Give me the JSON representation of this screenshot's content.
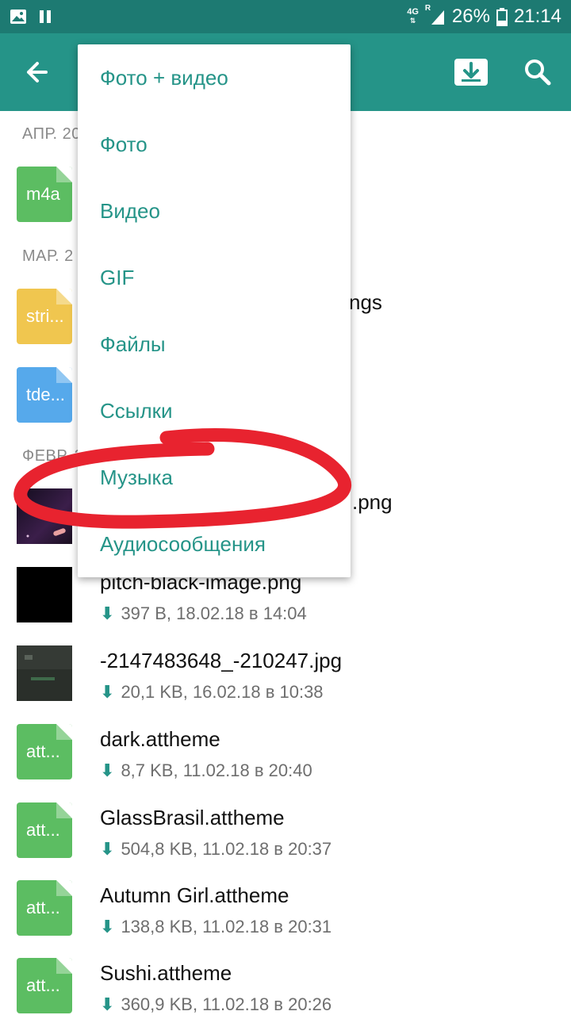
{
  "status_bar": {
    "network": "4G",
    "roaming": "R",
    "battery": "26%",
    "time": "21:14"
  },
  "colors": {
    "appbar": "#259488",
    "statusbar": "#1d7a72",
    "accent": "#259488",
    "annotation": "#e8232f"
  },
  "sections": [
    {
      "label": "АПР. 20"
    },
    {
      "label": "МАР. 2"
    },
    {
      "label": "ФЕВР. 2"
    }
  ],
  "visible_tail_texts": {
    "strings_tail": "ngs",
    "png_tail": ".png"
  },
  "files": [
    {
      "icon_label": "m4a",
      "icon_color": "#5cbd62"
    },
    {
      "icon_label": "stri...",
      "icon_color": "#f0c64f"
    },
    {
      "icon_label": "tde...",
      "icon_color": "#56a9eb"
    },
    {
      "icon": "dark-image-thumbnail"
    },
    {
      "name": "pitch-black-image.png",
      "meta": "397 B, 18.02.18 в 14:04"
    },
    {
      "name": "-2147483648_-210247.jpg",
      "meta": "20,1 KB, 16.02.18 в 10:38"
    },
    {
      "icon_label": "att...",
      "name": "dark.attheme",
      "meta": "8,7 KB, 11.02.18 в 20:40"
    },
    {
      "icon_label": "att...",
      "name": "GlassBrasil.attheme",
      "meta": "504,8 KB, 11.02.18 в 20:37"
    },
    {
      "icon_label": "att...",
      "name": "Autumn Girl.attheme",
      "meta": "138,8 KB, 11.02.18 в 20:31"
    },
    {
      "icon_label": "att...",
      "name": "Sushi.attheme",
      "meta": "360,9 KB, 11.02.18 в 20:26"
    }
  ],
  "menu": {
    "items": [
      "Фото + видео",
      "Фото",
      "Видео",
      "GIF",
      "Файлы",
      "Ссылки",
      "Музыка",
      "Аудиосообщения"
    ]
  },
  "download_arrow": "⬇"
}
